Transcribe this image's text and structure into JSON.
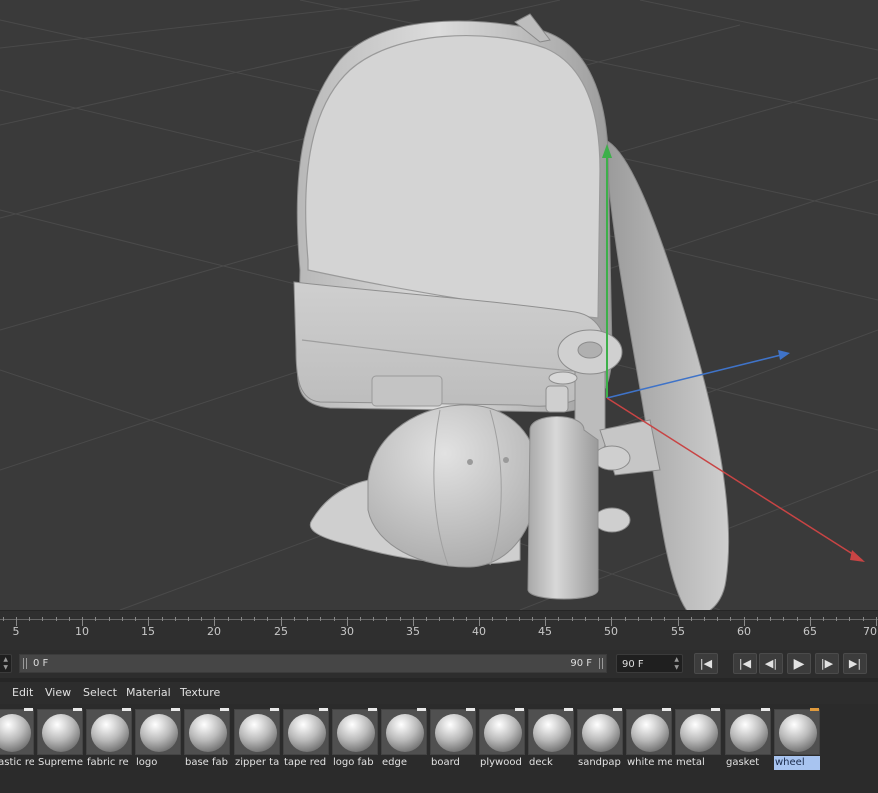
{
  "viewport": {
    "label": "3D viewport - backpack, cap, skateboard, bottle scene",
    "axis_colors": {
      "y": "#3db04a",
      "x": "#c84444",
      "z": "#3f73c8"
    },
    "object_color": "#c9c9c9",
    "background_color": "#3a3a3a"
  },
  "timeline": {
    "ruler_labels": [
      "5",
      "10",
      "15",
      "20",
      "25",
      "30",
      "35",
      "40",
      "45",
      "50",
      "55",
      "60",
      "65",
      "70"
    ],
    "current_frame": "0 F",
    "range_end": "90 F",
    "end_frame_field": "90 F",
    "buttons": {
      "record": "record-keyframe",
      "first": "go-to-start",
      "prev": "previous-frame",
      "play": "play",
      "next": "next-frame",
      "last": "go-to-end"
    }
  },
  "material_menu": {
    "items": [
      "Edit",
      "View",
      "Select",
      "Material",
      "Texture"
    ]
  },
  "materials": [
    {
      "name": "plastic re"
    },
    {
      "name": "Supreme"
    },
    {
      "name": "fabric re"
    },
    {
      "name": "logo"
    },
    {
      "name": "base fab"
    },
    {
      "name": "zipper ta"
    },
    {
      "name": "tape red"
    },
    {
      "name": "logo fab"
    },
    {
      "name": "edge"
    },
    {
      "name": "board"
    },
    {
      "name": "plywood"
    },
    {
      "name": "deck"
    },
    {
      "name": "sandpap"
    },
    {
      "name": "white me"
    },
    {
      "name": "metal"
    },
    {
      "name": "gasket"
    },
    {
      "name": "wheel"
    }
  ],
  "active_material": "wheel",
  "accent_color": "#e09a3c",
  "selection_color": "#a8c4f0"
}
